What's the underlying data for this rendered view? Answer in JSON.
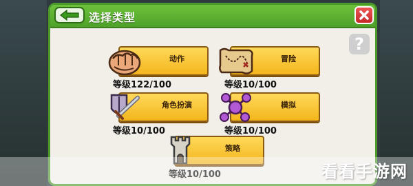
{
  "header": {
    "title": "选择类型",
    "back_icon": "back-arrow-icon",
    "close_icon": "close-icon"
  },
  "help": {
    "label": "?"
  },
  "types": [
    {
      "label": "动作",
      "level": "等级122/100",
      "icon": "fist-icon"
    },
    {
      "label": "冒险",
      "level": "等级10/100",
      "icon": "treasure-map-icon"
    },
    {
      "label": "角色扮演",
      "level": "等级10/100",
      "icon": "sword-shield-icon"
    },
    {
      "label": "模拟",
      "level": "等级10/100",
      "icon": "molecule-icon"
    },
    {
      "label": "策略",
      "level": "等级10/100",
      "icon": "castle-tower-icon"
    }
  ],
  "watermark": "看看手游网",
  "colors": {
    "header": "#5bb332",
    "button": "#f7c431",
    "close": "#d63030"
  }
}
